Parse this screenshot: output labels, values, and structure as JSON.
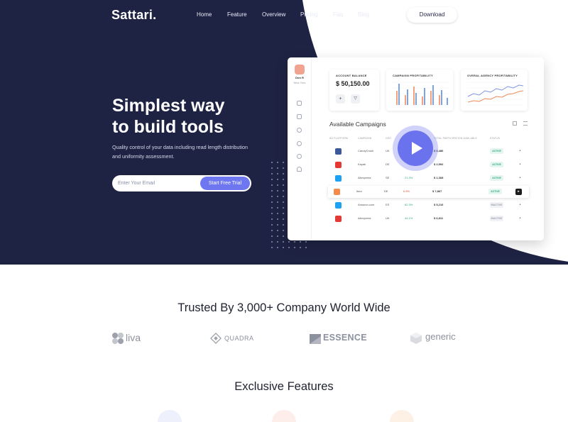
{
  "brand": {
    "logo": "Sattari."
  },
  "nav": {
    "items": [
      "Home",
      "Feature",
      "Overview",
      "Pricing",
      "Faq",
      "Blog"
    ],
    "download_label": "Download"
  },
  "hero": {
    "title_line1": "Simplest way",
    "title_line2": "to build tools",
    "subtitle_line1": "Quality control of your data including read length distribution",
    "subtitle_line2": "and uniformity assessment.",
    "email_placeholder": "Enter Your Email",
    "cta_label": "Start Free Trial"
  },
  "dashboard": {
    "user_name": "Don R",
    "user_location": "New York",
    "account_balance_title": "ACCOUNT BALANCE",
    "account_balance_value": "$ 50,150.00",
    "campaign_profitability_title": "CAMPAIGN PROFITABILITY",
    "overall_profitability_title": "OVERAL AGENCY PROFITABILITY",
    "campaigns_title": "Available Campaigns",
    "columns": [
      "AD PLATFORM",
      "CAMPAIGN",
      "GEO",
      "",
      "TOTAL PARTICIPATION AVAILABLE",
      "STATUS"
    ],
    "rows": [
      {
        "platform": "facebook",
        "color": "#3b5998",
        "campaign": "CandyCrush",
        "geo": "UK",
        "change": "",
        "amount": "$ 5,486",
        "status": "ACTIVE"
      },
      {
        "platform": "youtube",
        "color": "#e53935",
        "campaign": "Kayak",
        "geo": "DE",
        "change": "",
        "amount": "$ 2,592",
        "status": "ACTIVE"
      },
      {
        "platform": "twitter",
        "color": "#1da1f2",
        "campaign": "Aliexpress",
        "geo": "SE",
        "change": "21.3%",
        "amount": "$ 1,368",
        "status": "ACTIVE"
      },
      {
        "platform": "instagram",
        "color": "#f28b4b",
        "campaign": "Ikea",
        "geo": "DE",
        "change": "6.8%",
        "amount": "$ 7,867",
        "status": "ACTIVE"
      },
      {
        "platform": "twitter",
        "color": "#1da1f2",
        "campaign": "Amazon.com",
        "geo": "ES",
        "change": "62.3%",
        "amount": "$ 5,216",
        "status": "INACTIVE"
      },
      {
        "platform": "youtube",
        "color": "#e53935",
        "campaign": "Aliexpress",
        "geo": "UK",
        "change": "44.1%",
        "amount": "$ 6,811",
        "status": "INACTIVE"
      }
    ]
  },
  "trusted": {
    "title": "Trusted By 3,000+ Company World Wide",
    "brands": [
      "liva",
      "QUADRA",
      "ESSENCE",
      "generic"
    ]
  },
  "features": {
    "title": "Exclusive Features"
  },
  "colors": {
    "hero_bg": "#1f2343",
    "accent": "#6f77f0",
    "text_dark": "#1e2130"
  }
}
